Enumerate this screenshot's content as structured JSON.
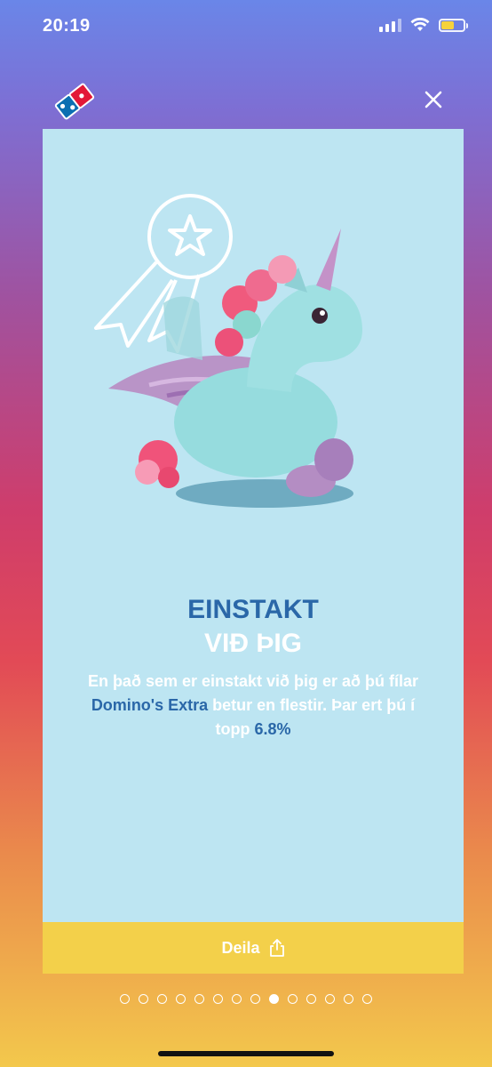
{
  "status_bar": {
    "time": "20:19",
    "battery_color": "#f6d23c",
    "battery_level": 0.6
  },
  "header": {
    "logo_icon": "dominos-logo-icon",
    "close_icon": "close-icon"
  },
  "card": {
    "background": "#bde5f2",
    "illustration": "unicorn-plush-with-award-badge",
    "title_line1": "EINSTAKT",
    "title_line2": "VIÐ ÞIG",
    "body_segments": [
      {
        "text": "En það sem er einstakt við þig er að þú fílar ",
        "highlight": false
      },
      {
        "text": "Domino's Extra",
        "highlight": true
      },
      {
        "text": " betur en flestir. Þar ert þú í topp ",
        "highlight": false
      },
      {
        "text": "6.8%",
        "highlight": true
      }
    ],
    "accent_color": "#2a67a8"
  },
  "share": {
    "label": "Deila",
    "icon": "share-icon",
    "background": "#f3d04a"
  },
  "pager": {
    "total": 14,
    "active_index": 8
  }
}
